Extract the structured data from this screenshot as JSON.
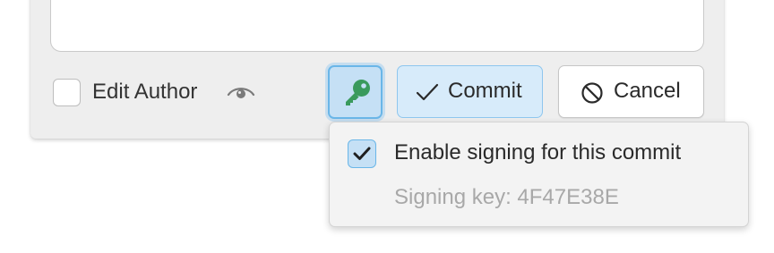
{
  "commit_panel": {
    "edit_author_label": "Edit Author",
    "commit_label": "Commit",
    "cancel_label": "Cancel"
  },
  "signing_popover": {
    "enable_label": "Enable signing for this commit",
    "enable_checked": true,
    "key_info": "Signing key: 4F47E38E"
  },
  "colors": {
    "accent": "#6ab6e8",
    "accent_fill": "#c5e0f5",
    "key_icon": "#3a9a5c",
    "panel_background": "#eeeeee"
  },
  "icons": {
    "visibility": "eye-icon",
    "signing": "key-icon",
    "commit": "check-icon",
    "cancel": "prohibited-icon",
    "checkbox_mark": "checkmark-icon"
  }
}
